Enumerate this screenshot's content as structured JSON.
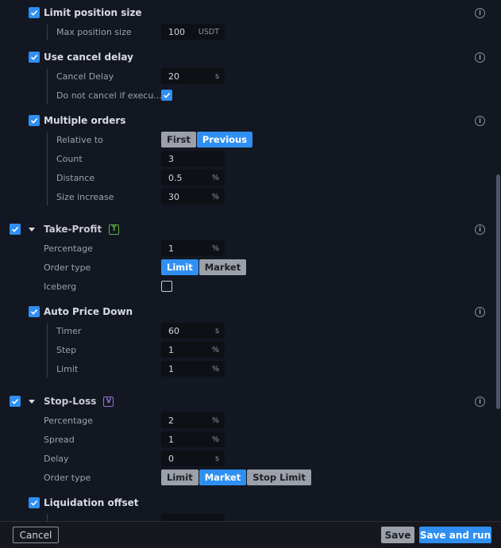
{
  "limit_position_size": {
    "title": "Limit position size",
    "max_position_size": {
      "label": "Max position size",
      "value": "100",
      "unit": "USDT"
    }
  },
  "use_cancel_delay": {
    "title": "Use cancel delay",
    "cancel_delay": {
      "label": "Cancel Delay",
      "value": "20",
      "unit": "s"
    },
    "do_not_cancel": {
      "label": "Do not cancel if execu..."
    }
  },
  "multiple_orders": {
    "title": "Multiple orders",
    "relative_to": {
      "label": "Relative to",
      "options": [
        "First",
        "Previous"
      ],
      "selected": "Previous"
    },
    "count": {
      "label": "Count",
      "value": "3",
      "unit": ""
    },
    "distance": {
      "label": "Distance",
      "value": "0.5",
      "unit": "%"
    },
    "size_increase": {
      "label": "Size increase",
      "value": "30",
      "unit": "%"
    }
  },
  "take_profit": {
    "title": "Take-Profit",
    "badge": "T",
    "percentage": {
      "label": "Percentage",
      "value": "1",
      "unit": "%"
    },
    "order_type": {
      "label": "Order type",
      "options": [
        "Limit",
        "Market"
      ],
      "selected": "Limit"
    },
    "iceberg": {
      "label": "Iceberg"
    },
    "auto_price_down": {
      "title": "Auto Price Down",
      "timer": {
        "label": "Timer",
        "value": "60",
        "unit": "s"
      },
      "step": {
        "label": "Step",
        "value": "1",
        "unit": "%"
      },
      "limit": {
        "label": "Limit",
        "value": "1",
        "unit": "%"
      }
    }
  },
  "stop_loss": {
    "title": "Stop-Loss",
    "badge": "V",
    "percentage": {
      "label": "Percentage",
      "value": "2",
      "unit": "%"
    },
    "spread": {
      "label": "Spread",
      "value": "1",
      "unit": "%"
    },
    "delay": {
      "label": "Delay",
      "value": "0",
      "unit": "s"
    },
    "order_type": {
      "label": "Order type",
      "options": [
        "Limit",
        "Market",
        "Stop Limit"
      ],
      "selected": "Market"
    },
    "liquidation_offset": {
      "title": "Liquidation offset"
    }
  },
  "info_glyph": "i",
  "footer": {
    "cancel_label": "Cancel",
    "save_label": "Save",
    "save_run_label": "Save and run"
  },
  "colors": {
    "accent": "#2f8ff2",
    "background": "#131722",
    "tp_badge": "#5fb14a",
    "sl_badge": "#8f6fd8"
  }
}
